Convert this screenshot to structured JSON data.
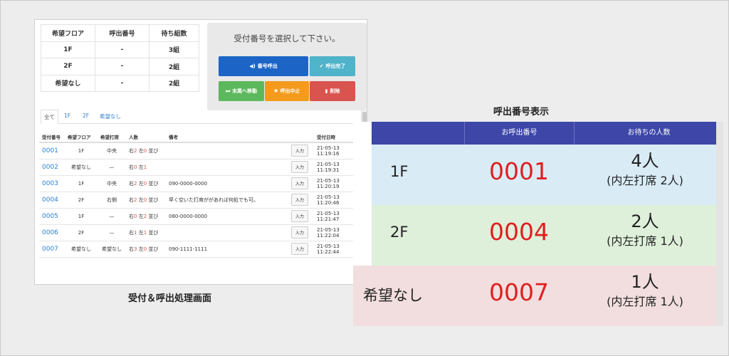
{
  "summary": {
    "headers": [
      "希望フロア",
      "呼出番号",
      "待ち組数"
    ],
    "rows": [
      [
        "1F",
        "-",
        "3組"
      ],
      [
        "2F",
        "-",
        "2組"
      ],
      [
        "希望なし",
        "-",
        "2組"
      ]
    ]
  },
  "call_panel": {
    "message": "受付番号を選択して下さい。",
    "buttons": {
      "call": "番号呼出",
      "done": "呼出完了",
      "move": "末尾へ移動",
      "stop": "呼出中止",
      "delete": "削除"
    }
  },
  "tabs": [
    "全て",
    "1F",
    "2F",
    "希望なし"
  ],
  "list": {
    "headers": [
      "受付番号",
      "希望フロア",
      "希望打席",
      "人数",
      "備考",
      "",
      "受付日時"
    ],
    "input_label": "入力",
    "rows": [
      {
        "num": "0001",
        "floor": "1F",
        "seat": "中央",
        "people": [
          "右",
          "2",
          " 左",
          "0",
          " 並び"
        ],
        "note": "",
        "time": "21-05-13 11:19:16"
      },
      {
        "num": "0002",
        "floor": "希望なし",
        "seat": "—",
        "people": [
          "右",
          "0",
          " 左",
          "1",
          ""
        ],
        "note": "",
        "time": "21-05-13 11:19:31"
      },
      {
        "num": "0003",
        "floor": "1F",
        "seat": "中央",
        "people": [
          "右",
          "2",
          " 左",
          "0",
          " 並び"
        ],
        "note": "090-0000-0000",
        "time": "21-05-13 11:20:19"
      },
      {
        "num": "0004",
        "floor": "2F",
        "seat": "右側",
        "people": [
          "右",
          "2",
          " 左",
          "0",
          " 並び"
        ],
        "note": "早く空いた打席ががあれば何処でも可。",
        "time": "21-05-13 11:20:46"
      },
      {
        "num": "0005",
        "floor": "1F",
        "seat": "—",
        "people": [
          "右",
          "0",
          " 左",
          "2",
          " 並び"
        ],
        "note": "080-0000-0000",
        "time": "21-05-13 11:21:47"
      },
      {
        "num": "0006",
        "floor": "2F",
        "seat": "—",
        "people": [
          "右",
          "1",
          " 左",
          "1",
          " 並び"
        ],
        "note": "",
        "time": "21-05-13 11:22:04"
      },
      {
        "num": "0007",
        "floor": "希望なし",
        "seat": "希望なし",
        "people": [
          "右",
          "3",
          " 左",
          "0",
          " 並び"
        ],
        "note": "090-1111-1111",
        "time": "21-05-13 11:22:44"
      }
    ]
  },
  "captions": {
    "left": "受付＆呼出処理画面",
    "right": "呼出番号表示"
  },
  "display": {
    "headers": [
      "",
      "お呼出番号",
      "お待ちの人数"
    ],
    "rows": [
      {
        "floor": "1F",
        "number": "0001",
        "wait": "4人",
        "detail": "(内左打席 2人)"
      },
      {
        "floor": "2F",
        "number": "0004",
        "wait": "2人",
        "detail": "(内左打席 1人)"
      },
      {
        "floor": "希望なし",
        "number": "0007",
        "wait": "1人",
        "detail": "(内左打席 1人)"
      }
    ]
  },
  "colors": {
    "primary": "#1c65c7",
    "info": "#4fb3c9",
    "success": "#5cb85c",
    "warning": "#f49a1c",
    "danger": "#d9534f",
    "display_header": "#3e47a8",
    "display_number": "#e01f1f"
  },
  "icons": {
    "call": "speaker-icon",
    "done": "check-icon",
    "move": "skip-end-icon",
    "stop": "x-icon",
    "delete": "trash-icon"
  }
}
